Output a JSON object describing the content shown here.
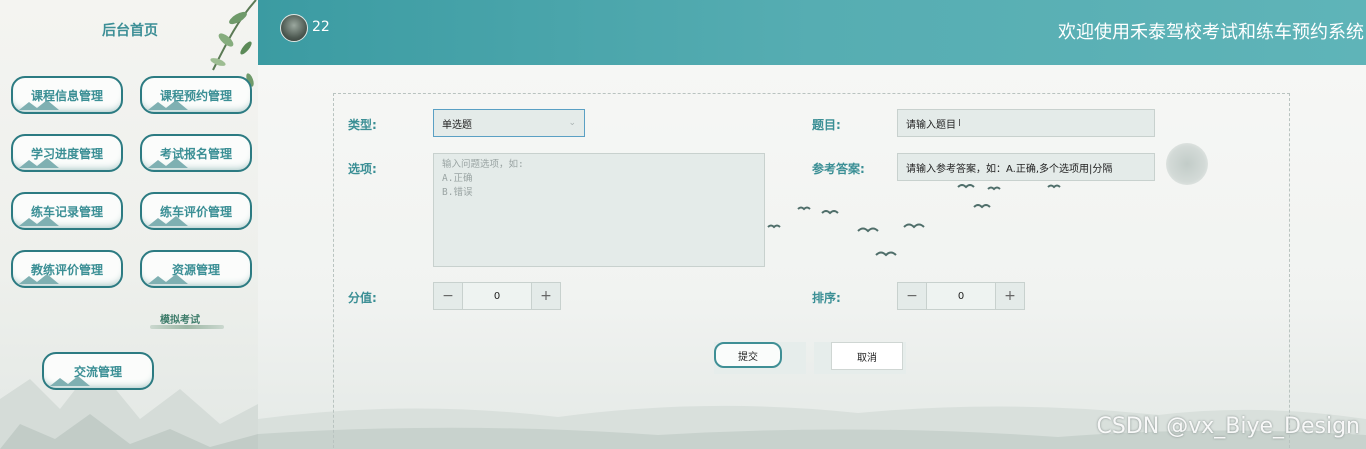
{
  "sidebar": {
    "home": "后台首页",
    "items": [
      {
        "label": "课程信息管理"
      },
      {
        "label": "课程预约管理"
      },
      {
        "label": "学习进度管理"
      },
      {
        "label": "考试报名管理"
      },
      {
        "label": "练车记录管理"
      },
      {
        "label": "练车评价管理"
      },
      {
        "label": "教练评价管理"
      },
      {
        "label": "资源管理"
      },
      {
        "label": "模拟考试"
      },
      {
        "label": "交流管理"
      }
    ]
  },
  "header": {
    "username": "22",
    "title": "欢迎使用禾泰驾校考试和练车预约系统"
  },
  "form": {
    "type_label": "类型:",
    "type_value": "单选题",
    "question_label": "题目:",
    "question_placeholder": "请输入题目",
    "options_label": "选项:",
    "options_placeholder_lines": [
      "输入问题选项，如:",
      "A.正确",
      "B.错误"
    ],
    "answer_label": "参考答案:",
    "answer_placeholder": "请输入参考答案，如：A.正确,多个选项用|分隔",
    "score_label": "分值:",
    "score_value": "0",
    "sort_label": "排序:",
    "sort_value": "0",
    "submit_label": "提交",
    "cancel_label": "取消"
  },
  "watermark": "CSDN @vx_Biye_Design",
  "colors": {
    "header": "#4aa6ac",
    "accent": "#3b8f95"
  }
}
